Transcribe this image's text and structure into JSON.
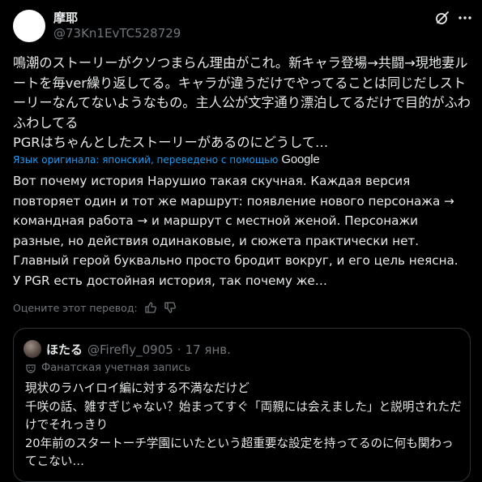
{
  "post": {
    "author": {
      "name": "摩耶",
      "handle": "@73Kn1EvTC528729"
    },
    "icons": {
      "grok": "grok-icon",
      "more": "more-icon"
    },
    "original_text": "鳴潮のストーリーがクソつまらん理由がこれ。新キャラ登場→共闘→現地妻ルートを毎ver繰り返してる。キャラが違うだけでやってることは同じだしストーリーなんてないようなもの。主人公が文字通り漂泊してるだけで目的がふわふわしてる\nPGRはちゃんとしたストーリーがあるのにどうして…",
    "translation_notice": "Язык оригинала: японский, переведено с помощью",
    "translation_provider": "Google",
    "translated_text": "Вот почему история Нарушио такая скучная. Каждая версия повторяет один и тот же маршрут: появление нового персонажа → командная работа → и маршрут с местной женой. Персонажи разные, но действия одинаковые, и сюжета практически нет. Главный герой буквально просто бродит вокруг, и его цель неясна.\nУ PGR есть достойная история, так почему же…",
    "rate_label": "Оцените этот перевод:",
    "rate_icons": [
      "thumbs-up-icon",
      "thumbs-down-icon"
    ]
  },
  "quote": {
    "author": {
      "name": "ほたる",
      "handle": "@Firefly_0905",
      "separator": "·",
      "date": "17 янв."
    },
    "account_label": "Фанатская учетная запись",
    "text": "現状のラハイロイ編に対する不満なだけど\n千咲の話、雑すぎじゃない？始まってすぐ「両親には会えました」と説明されただけでそれっきり\n20年前のスタートーチ学園にいたという超重要な設定を持ってるのに何も関わってこない…"
  },
  "colors": {
    "background": "#000000",
    "text": "#e7e9ea",
    "muted": "#71767b",
    "link": "#1d9bf0",
    "border": "#2f3336"
  }
}
